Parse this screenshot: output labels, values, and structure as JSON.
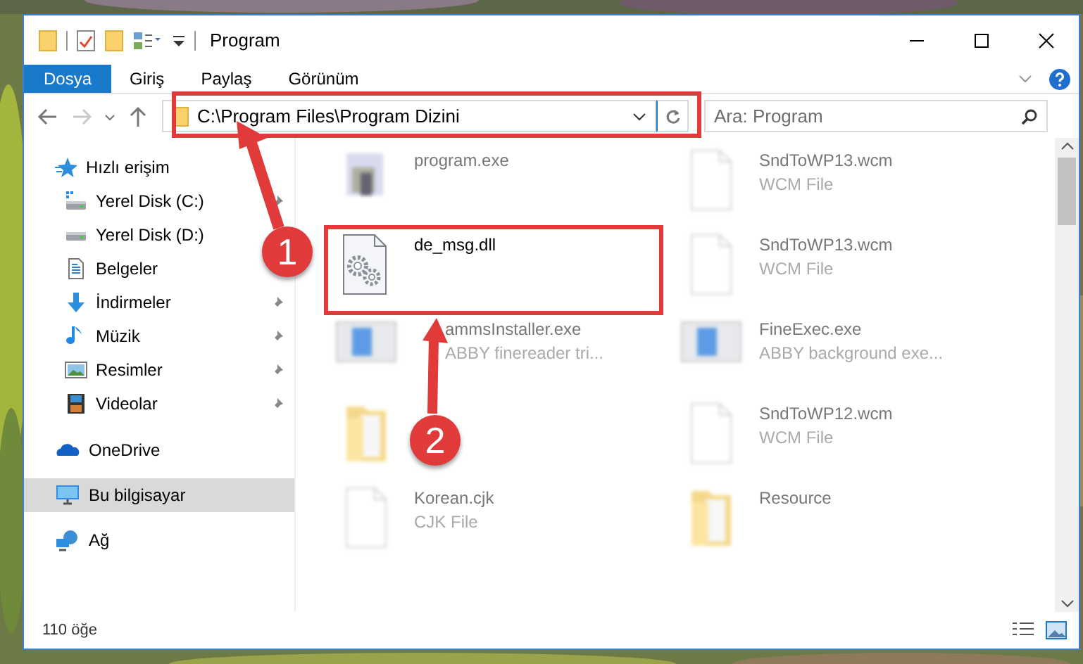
{
  "window": {
    "title": "Program"
  },
  "ribbon_tabs": [
    {
      "label": "Dosya",
      "selected": true
    },
    {
      "label": "Giriş",
      "selected": false
    },
    {
      "label": "Paylaş",
      "selected": false
    },
    {
      "label": "Görünüm",
      "selected": false
    }
  ],
  "address": {
    "path": "C:\\Program Files\\Program Dizini"
  },
  "search": {
    "placeholder": "Ara: Program"
  },
  "nav": [
    {
      "label": "Hızlı erişim",
      "kind": "star",
      "selected": false,
      "children": [
        {
          "label": "Yerel Disk (C:)",
          "kind": "drive-c",
          "pinned": true,
          "selected": false
        },
        {
          "label": "Yerel Disk (D:)",
          "kind": "drive",
          "selected": false
        },
        {
          "label": "Belgeler",
          "kind": "docs",
          "selected": false
        },
        {
          "label": "İndirmeler",
          "kind": "download",
          "pinned": true,
          "selected": false
        },
        {
          "label": "Müzik",
          "kind": "music",
          "pinned": true,
          "selected": false
        },
        {
          "label": "Resimler",
          "kind": "pictures",
          "pinned": true,
          "selected": false
        },
        {
          "label": "Videolar",
          "kind": "video",
          "pinned": true,
          "selected": false
        }
      ]
    },
    {
      "label": "OneDrive",
      "kind": "cloud",
      "selected": false
    },
    {
      "label": "Bu bilgisayar",
      "kind": "pc",
      "selected": true
    },
    {
      "label": "Ağ",
      "kind": "network",
      "selected": false
    }
  ],
  "files": [
    {
      "name": "program.exe",
      "kind": "app",
      "blurred": true
    },
    {
      "name": "SndToWP13.wcm",
      "type": "WCM File",
      "kind": "doc",
      "blurred": true
    },
    {
      "name": "de_msg.dll",
      "kind": "dll",
      "blurred": false
    },
    {
      "name": "SndToWP13.wcm",
      "type": "WCM File",
      "kind": "doc",
      "blurred": true
    },
    {
      "name": "ammsInstaller.exe",
      "type": "ABBY finereader tri...",
      "kind": "window",
      "blurred": true
    },
    {
      "name": "FineExec.exe",
      "type": "ABBY background exe...",
      "kind": "window",
      "blurred": true
    },
    {
      "kind": "folder-doc",
      "blurred": true
    },
    {
      "name": "SndToWP12.wcm",
      "type": "WCM File",
      "kind": "doc",
      "blurred": true
    },
    {
      "name": "Korean.cjk",
      "type": "CJK File",
      "kind": "doc",
      "blurred": true
    },
    {
      "name": "Resource",
      "kind": "folder-doc",
      "blurred": true
    }
  ],
  "callouts": [
    {
      "number": "1"
    },
    {
      "number": "2"
    }
  ],
  "status_bar": {
    "count": "110 öğe"
  }
}
